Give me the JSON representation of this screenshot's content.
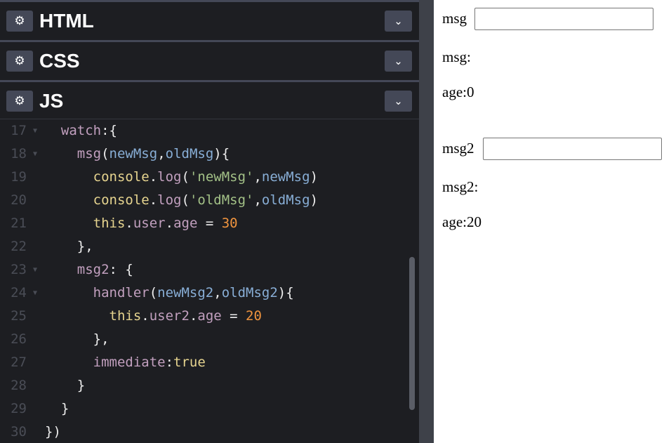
{
  "panels": [
    {
      "icon": "⚙",
      "title": "HTML",
      "chevron": "⌄"
    },
    {
      "icon": "⚙",
      "title": "CSS",
      "chevron": "⌄"
    },
    {
      "icon": "⚙",
      "title": "JS",
      "chevron": "⌄"
    }
  ],
  "code": [
    {
      "n": "17",
      "fold": "▼",
      "tokens": [
        {
          "t": "  ",
          "c": "p"
        },
        {
          "t": "watch",
          "c": "prop"
        },
        {
          "t": ":{",
          "c": "p"
        }
      ]
    },
    {
      "n": "18",
      "fold": "▼",
      "tokens": [
        {
          "t": "    ",
          "c": "p"
        },
        {
          "t": "msg",
          "c": "prop"
        },
        {
          "t": "(",
          "c": "p"
        },
        {
          "t": "newMsg",
          "c": "param"
        },
        {
          "t": ",",
          "c": "p"
        },
        {
          "t": "oldMsg",
          "c": "param"
        },
        {
          "t": "){",
          "c": "p"
        }
      ]
    },
    {
      "n": "19",
      "fold": "",
      "tokens": [
        {
          "t": "      ",
          "c": "p"
        },
        {
          "t": "console",
          "c": "con"
        },
        {
          "t": ".",
          "c": "p"
        },
        {
          "t": "log",
          "c": "prop"
        },
        {
          "t": "(",
          "c": "p"
        },
        {
          "t": "'newMsg'",
          "c": "str"
        },
        {
          "t": ",",
          "c": "p"
        },
        {
          "t": "newMsg",
          "c": "param"
        },
        {
          "t": ")",
          "c": "p"
        }
      ]
    },
    {
      "n": "20",
      "fold": "",
      "tokens": [
        {
          "t": "      ",
          "c": "p"
        },
        {
          "t": "console",
          "c": "con"
        },
        {
          "t": ".",
          "c": "p"
        },
        {
          "t": "log",
          "c": "prop"
        },
        {
          "t": "(",
          "c": "p"
        },
        {
          "t": "'oldMsg'",
          "c": "str"
        },
        {
          "t": ",",
          "c": "p"
        },
        {
          "t": "oldMsg",
          "c": "param"
        },
        {
          "t": ")",
          "c": "p"
        }
      ]
    },
    {
      "n": "21",
      "fold": "",
      "tokens": [
        {
          "t": "      ",
          "c": "p"
        },
        {
          "t": "this",
          "c": "con"
        },
        {
          "t": ".",
          "c": "p"
        },
        {
          "t": "user",
          "c": "prop"
        },
        {
          "t": ".",
          "c": "p"
        },
        {
          "t": "age",
          "c": "prop"
        },
        {
          "t": " = ",
          "c": "p"
        },
        {
          "t": "30",
          "c": "num"
        }
      ]
    },
    {
      "n": "22",
      "fold": "",
      "tokens": [
        {
          "t": "    },",
          "c": "p"
        }
      ]
    },
    {
      "n": "23",
      "fold": "▼",
      "tokens": [
        {
          "t": "    ",
          "c": "p"
        },
        {
          "t": "msg2",
          "c": "prop"
        },
        {
          "t": ": {",
          "c": "p"
        }
      ]
    },
    {
      "n": "24",
      "fold": "▼",
      "tokens": [
        {
          "t": "      ",
          "c": "p"
        },
        {
          "t": "handler",
          "c": "prop"
        },
        {
          "t": "(",
          "c": "p"
        },
        {
          "t": "newMsg2",
          "c": "param"
        },
        {
          "t": ",",
          "c": "p"
        },
        {
          "t": "oldMsg2",
          "c": "param"
        },
        {
          "t": "){",
          "c": "p"
        }
      ]
    },
    {
      "n": "25",
      "fold": "",
      "tokens": [
        {
          "t": "        ",
          "c": "p"
        },
        {
          "t": "this",
          "c": "con"
        },
        {
          "t": ".",
          "c": "p"
        },
        {
          "t": "user2",
          "c": "prop"
        },
        {
          "t": ".",
          "c": "p"
        },
        {
          "t": "age",
          "c": "prop"
        },
        {
          "t": " = ",
          "c": "p"
        },
        {
          "t": "20",
          "c": "num"
        }
      ]
    },
    {
      "n": "26",
      "fold": "",
      "tokens": [
        {
          "t": "      },",
          "c": "p"
        }
      ]
    },
    {
      "n": "27",
      "fold": "",
      "tokens": [
        {
          "t": "      ",
          "c": "p"
        },
        {
          "t": "immediate",
          "c": "prop"
        },
        {
          "t": ":",
          "c": "p"
        },
        {
          "t": "true",
          "c": "con"
        }
      ]
    },
    {
      "n": "28",
      "fold": "",
      "tokens": [
        {
          "t": "    }",
          "c": "p"
        }
      ]
    },
    {
      "n": "29",
      "fold": "",
      "tokens": [
        {
          "t": "  }",
          "c": "p"
        }
      ]
    },
    {
      "n": "30",
      "fold": "",
      "tokens": [
        {
          "t": "})",
          "c": "p"
        }
      ]
    }
  ],
  "preview": {
    "msg_label": "msg",
    "msg_value": "",
    "msg_display": "msg:",
    "age1": "age:0",
    "msg2_label": "msg2",
    "msg2_value": "",
    "msg2_display": "msg2:",
    "age2": "age:20"
  }
}
